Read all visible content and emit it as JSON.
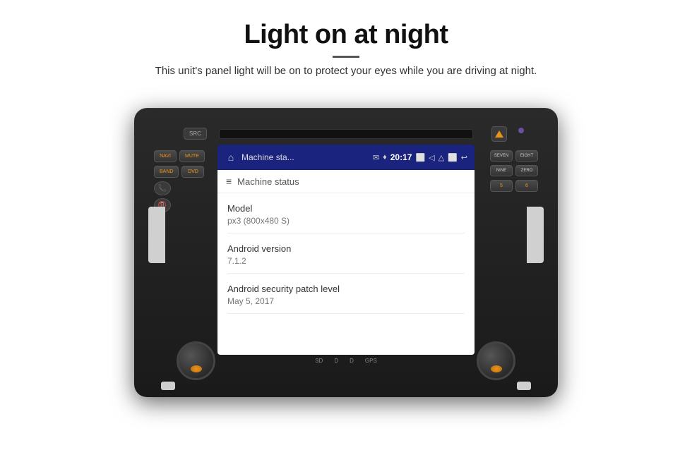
{
  "header": {
    "title": "Light on at night",
    "divider": true,
    "subtitle": "This unit's panel light will be on to protect your eyes while you are driving at night."
  },
  "unit": {
    "buttons": {
      "src": "SRC",
      "navi": "NAVI",
      "mute": "MUTE",
      "band": "BAND",
      "dvd": "DVD",
      "seven": "SEVEN",
      "eight": "EIGHT",
      "nine": "NINE",
      "zero": "ZERO"
    },
    "sd_labels": [
      "SD",
      "D",
      "D",
      "GPS"
    ],
    "screen": {
      "status_bar": {
        "app_name": "Machine sta...",
        "time": "20:17"
      },
      "content": {
        "header": "Machine status",
        "rows": [
          {
            "label": "Model",
            "value": "px3 (800x480 S)"
          },
          {
            "label": "Android version",
            "value": "7.1.2"
          },
          {
            "label": "Android security patch level",
            "value": "May 5, 2017"
          }
        ]
      }
    }
  }
}
